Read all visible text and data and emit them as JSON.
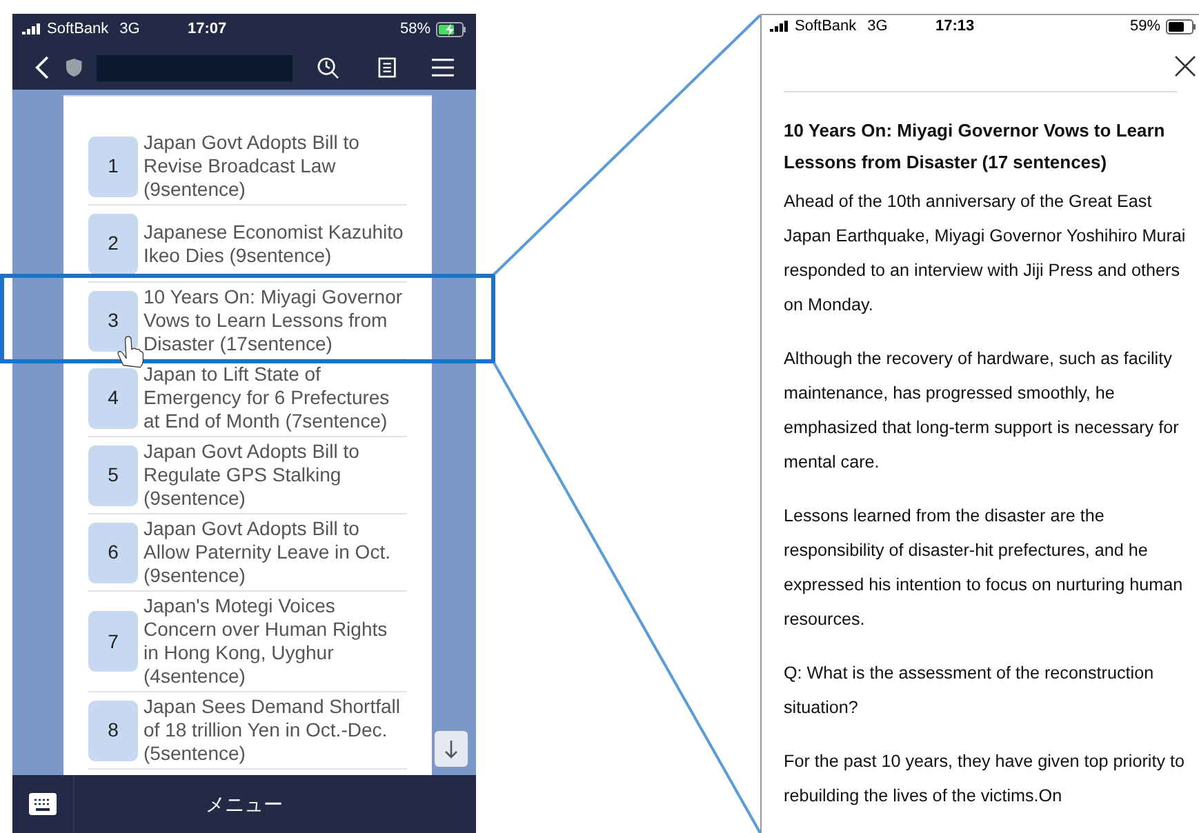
{
  "left_screen": {
    "status_bar": {
      "carrier": "SoftBank",
      "network": "3G",
      "time": "17:07",
      "battery": "58%",
      "charging": true
    },
    "articles": [
      {
        "number": "1",
        "title": "Japan Govt Adopts Bill to Revise Broadcast Law (9sentence)"
      },
      {
        "number": "2",
        "title": "Japanese Economist Kazuhito Ikeo Dies (9sentence)"
      },
      {
        "number": "3",
        "title": "10 Years On: Miyagi Governor Vows to Learn Lessons from Disaster (17sentence)"
      },
      {
        "number": "4",
        "title": "Japan to Lift State of Emergency for 6 Prefectures at End of Month (7sentence)"
      },
      {
        "number": "5",
        "title": "Japan Govt Adopts Bill to Regulate GPS Stalking (9sentence)"
      },
      {
        "number": "6",
        "title": "Japan Govt Adopts Bill to Allow Paternity Leave in Oct. (9sentence)"
      },
      {
        "number": "7",
        "title": "Japan's Motegi Voices Concern over Human Rights in Hong Kong, Uyghur (4sentence)"
      },
      {
        "number": "8",
        "title": "Japan Sees Demand Shortfall of 18 trillion Yen in Oct.-Dec. (5sentence)"
      }
    ],
    "bottom_bar": {
      "menu_label": "メニュー"
    }
  },
  "right_screen": {
    "status_bar": {
      "carrier": "SoftBank",
      "network": "3G",
      "time": "17:13",
      "battery": "59%",
      "charging": false
    },
    "article": {
      "title": "10 Years On: Miyagi Governor Vows to Learn Lessons from Disaster (17 sentences)",
      "paragraphs": [
        "Ahead of the 10th anniversary of the Great East Japan Earthquake, Miyagi Governor Yoshihiro Murai responded to an interview with Jiji Press and others on Monday.",
        "Although the recovery of hardware, such as facility maintenance, has progressed smoothly, he emphasized that long-term support is necessary for mental care.",
        "Lessons learned from the disaster are the responsibility of disaster-hit prefectures, and he expressed his intention to focus on nurturing human resources.",
        "Q: What is the assessment of the reconstruction situation?",
        "For the past 10 years, they have given top priority to rebuilding the lives of the victims.On"
      ]
    }
  }
}
